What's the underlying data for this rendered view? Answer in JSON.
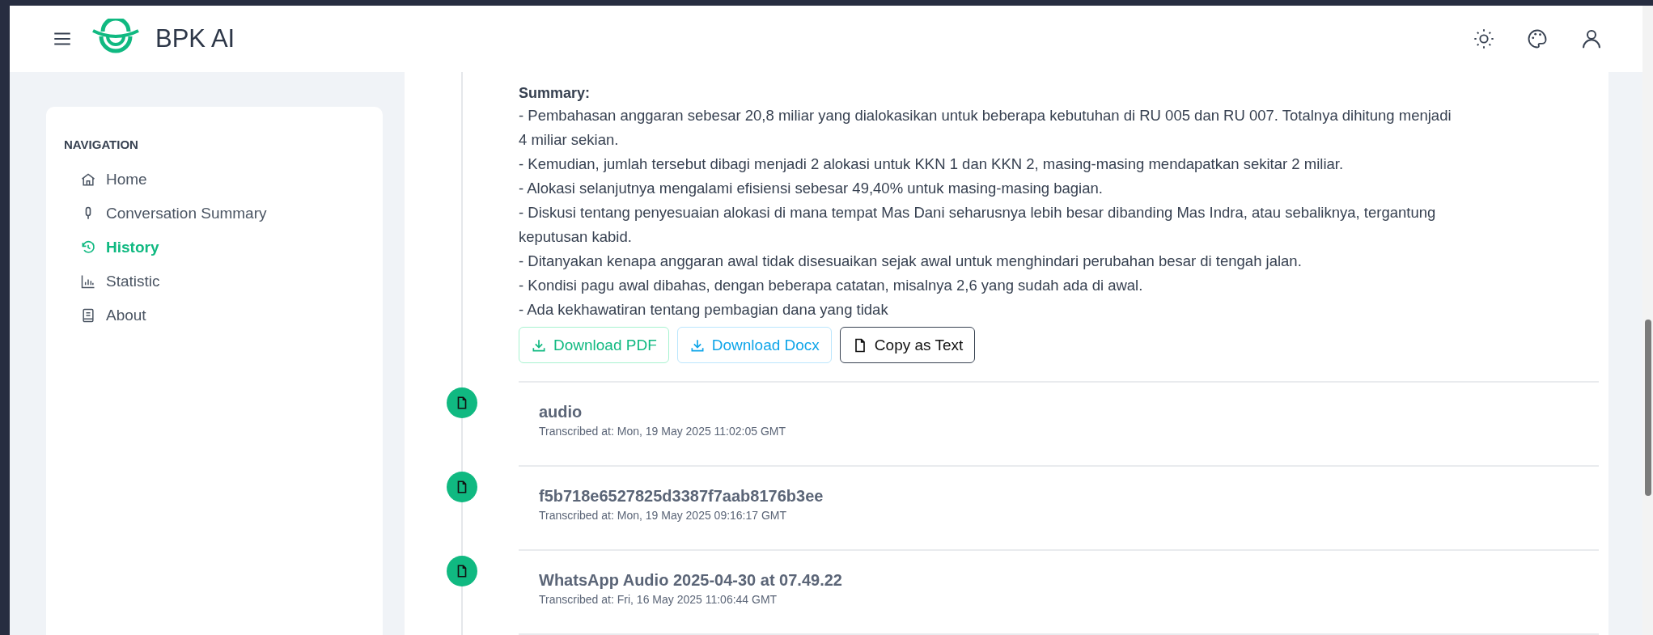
{
  "header": {
    "brand": "BPK AI"
  },
  "sidebar": {
    "heading": "NAVIGATION",
    "items": [
      {
        "kind": "home",
        "label": "Home",
        "selected": false
      },
      {
        "kind": "mic",
        "label": "Conversation Summary",
        "selected": false
      },
      {
        "kind": "history",
        "label": "History",
        "selected": true
      },
      {
        "kind": "chart",
        "label": "Statistic",
        "selected": false
      },
      {
        "kind": "book",
        "label": "About",
        "selected": false
      }
    ]
  },
  "history": {
    "summary_title": "Summary:",
    "summary_lines": [
      "- Pembahasan anggaran sebesar 20,8 miliar yang dialokasikan untuk beberapa kebutuhan di RU 005 dan RU 007. Totalnya dihitung menjadi 4 miliar sekian.",
      "- Kemudian, jumlah tersebut dibagi menjadi 2 alokasi untuk KKN 1 dan KKN 2, masing-masing mendapatkan sekitar 2 miliar.",
      "- Alokasi selanjutnya mengalami efisiensi sebesar 49,40% untuk masing-masing bagian.",
      "- Diskusi tentang penyesuaian alokasi di mana tempat Mas Dani seharusnya lebih besar dibanding Mas Indra, atau sebaliknya, tergantung keputusan kabid.",
      "- Ditanyakan kenapa anggaran awal tidak disesuaikan sejak awal untuk menghindari perubahan besar di tengah jalan.",
      "- Kondisi pagu awal dibahas, dengan beberapa catatan, misalnya 2,6 yang sudah ada di awal.",
      "- Ada kekhawatiran tentang pembagian dana yang tidak"
    ],
    "buttons": [
      {
        "kind": "pdf",
        "label": "Download PDF"
      },
      {
        "kind": "docx",
        "label": "Download Docx"
      },
      {
        "kind": "copy",
        "label": "Copy as Text"
      }
    ],
    "entries": [
      {
        "title": "audio",
        "subtitle": "Transcribed at: Mon, 19 May 2025 11:02:05 GMT"
      },
      {
        "title": "f5b718e6527825d3387f7aab8176b3ee",
        "subtitle": "Transcribed at: Mon, 19 May 2025 09:16:17 GMT"
      },
      {
        "title": "WhatsApp Audio 2025-04-30 at 07.49.22",
        "subtitle": "Transcribed at: Fri, 16 May 2025 11:06:44 GMT"
      }
    ]
  }
}
